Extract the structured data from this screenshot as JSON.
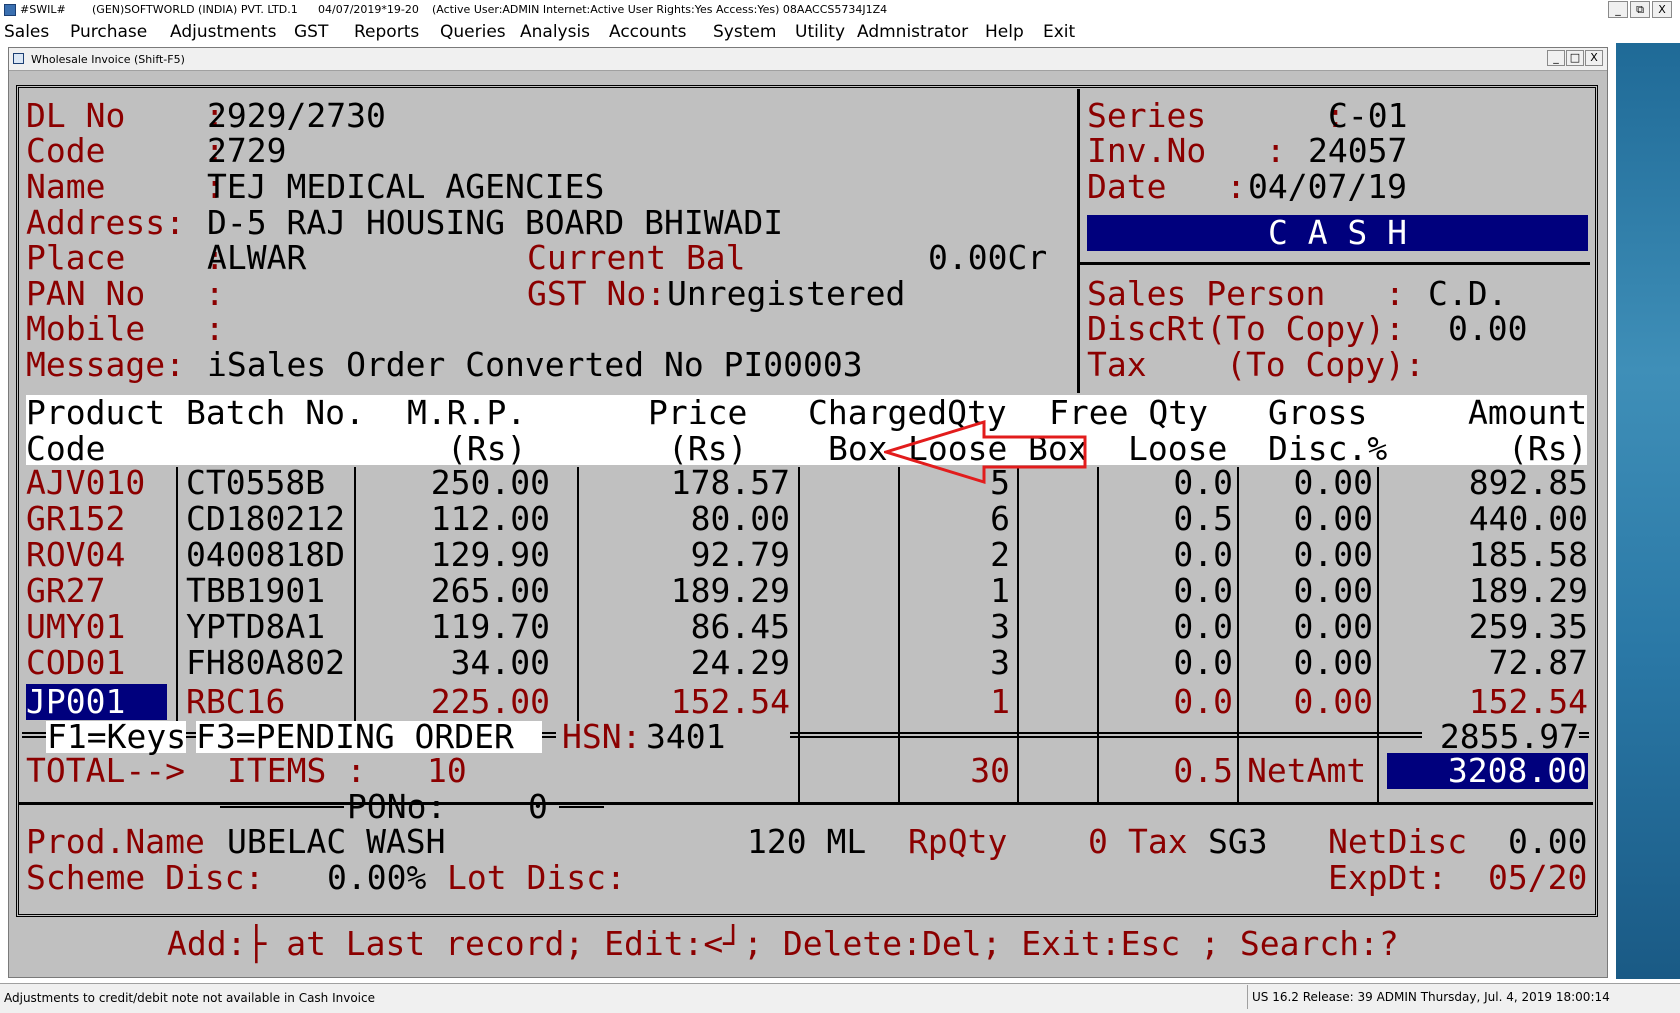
{
  "titlebar": {
    "app": "#SWIL#",
    "company": "(GEN)SOFTWORLD (INDIA) PVT. LTD.1",
    "datetime": "04/07/2019*19-20",
    "session": "(Active User:ADMIN Internet:Active  User Rights:Yes Access:Yes) 08AACCS5734J1Z4",
    "min": "_",
    "restore": "⧉",
    "close": "X"
  },
  "menu": [
    "Sales",
    "Purchase",
    "Adjustments",
    "GST",
    "Reports",
    "Queries",
    "Analysis",
    "Accounts",
    "System",
    "Utility",
    "Admnistrator",
    "Help",
    "Exit"
  ],
  "window": {
    "title": "Wholesale Invoice (Shift-F5)",
    "min": "_",
    "max": "□",
    "close": "X"
  },
  "party": {
    "dl_label": "DL No    :",
    "dl": "2929/2730",
    "code_label": "Code     :",
    "code": "2729",
    "name_label": "Name     :",
    "name": "TEJ MEDICAL AGENCIES",
    "address_label": "Address:",
    "address": "D-5 RAJ HOUSING BOARD BHIWADI",
    "place_label": "Place    :",
    "place": "ALWAR",
    "curbal_label": "Current Bal",
    "curbal": "0.00Cr",
    "pan_label": "PAN No   :",
    "gst_label": "GST No:",
    "gst": "Unregistered",
    "mobile_label": "Mobile   :",
    "message_label": "Message:",
    "message": "iSales Order Converted No PI00003"
  },
  "invoice": {
    "series_label": "Series      :",
    "series": "C-01",
    "invno_label": "Inv.No   :",
    "invno": "24057",
    "date_label": "Date   :",
    "date": "04/07/19",
    "mode": "C A S H",
    "salesperson_label": "Sales Person   :",
    "salesperson": "C.D.",
    "discrt_label": "DiscRt(To Copy):",
    "discrt": "0.00",
    "tax_label": "Tax    (To Copy):"
  },
  "columns": {
    "h1": [
      "Product",
      "Batch No.",
      "M.R.P.",
      "Price",
      "ChargedQty",
      "Free Qty",
      "Gross",
      "Amount"
    ],
    "h2": [
      "Code",
      "(Rs)",
      "(Rs)",
      "Box",
      "Loose",
      "Box",
      "Loose",
      "Disc.%",
      "(Rs)"
    ]
  },
  "rows": [
    {
      "code": "AJV010",
      "batch": "CT0558B",
      "mrp": "250.00",
      "price": "178.57",
      "cbox": "",
      "cloose": "5",
      "fbox": "",
      "floose": "0.0",
      "disc": "0.00",
      "amount": "892.85"
    },
    {
      "code": "GR152",
      "batch": "CD180212",
      "mrp": "112.00",
      "price": "80.00",
      "cbox": "",
      "cloose": "6",
      "fbox": "",
      "floose": "0.5",
      "disc": "0.00",
      "amount": "440.00"
    },
    {
      "code": "ROV04",
      "batch": "0400818D",
      "mrp": "129.90",
      "price": "92.79",
      "cbox": "",
      "cloose": "2",
      "fbox": "",
      "floose": "0.0",
      "disc": "0.00",
      "amount": "185.58"
    },
    {
      "code": "GR27",
      "batch": "TBB1901",
      "mrp": "265.00",
      "price": "189.29",
      "cbox": "",
      "cloose": "1",
      "fbox": "",
      "floose": "0.0",
      "disc": "0.00",
      "amount": "189.29"
    },
    {
      "code": "UMY01",
      "batch": "YPTD8A1",
      "mrp": "119.70",
      "price": "86.45",
      "cbox": "",
      "cloose": "3",
      "fbox": "",
      "floose": "0.0",
      "disc": "0.00",
      "amount": "259.35"
    },
    {
      "code": "COD01",
      "batch": "FH80A802",
      "mrp": "34.00",
      "price": "24.29",
      "cbox": "",
      "cloose": "3",
      "fbox": "",
      "floose": "0.0",
      "disc": "0.00",
      "amount": "72.87"
    },
    {
      "code": "JP001",
      "batch": "RBC16",
      "mrp": "225.00",
      "price": "152.54",
      "cbox": "",
      "cloose": "1",
      "fbox": "",
      "floose": "0.0",
      "disc": "0.00",
      "amount": "152.54"
    }
  ],
  "keys": {
    "f1": "F1=Keys",
    "f3": "F3=PENDING ORDER",
    "hsn_label": "HSN:",
    "hsn": "3401",
    "gross_total": "2855.97"
  },
  "totals": {
    "label": "TOTAL-->",
    "items_label": "ITEMS :",
    "items": "10",
    "qty": "30",
    "free": "0.5",
    "netamt_label": "NetAmt",
    "netamt": "3208.00",
    "pono_label": "PONo:",
    "pono": "0"
  },
  "footer": {
    "prodname_label": "Prod.Name",
    "prodname": "UBELAC WASH",
    "pack": "120 ML",
    "rpqty_label": "RpQty",
    "rpqty": "0",
    "tax_label": "Tax",
    "tax": "SG3",
    "netdisc_label": "NetDisc",
    "netdisc": "0.00",
    "scheme_label": "Scheme Disc:",
    "scheme": "0.00%",
    "lot_label": "Lot Disc:",
    "expdt_label": "ExpDt:",
    "expdt": "05/20"
  },
  "hint": "Add:├ at Last record; Edit:<┘; Delete:Del; Exit:Esc ; Search:?",
  "status": {
    "left": "Adjustments to credit/debit note not available in Cash Invoice",
    "right": "US 16.2 Release: 39 ADMIN  Thursday, Jul.  4, 2019  18:00:14"
  },
  "colors": {
    "label_red": "#8b0000",
    "highlight_blue": "#00007d",
    "arrow_red": "#e21c1c",
    "screen_gray": "#c0c0c0"
  }
}
